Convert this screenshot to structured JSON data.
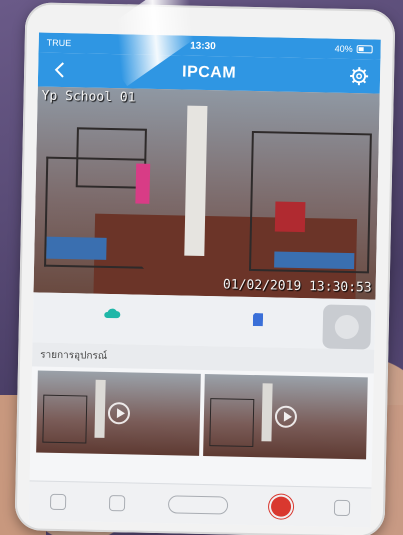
{
  "status_bar": {
    "carrier": "TRUE",
    "time": "13:30",
    "battery": "40%"
  },
  "nav_bar": {
    "title": "IPCAM",
    "back_icon": "chevron-left-icon",
    "settings_icon": "gear-icon"
  },
  "live_view": {
    "camera_label": "Yp School 01",
    "timestamp": "01/02/2019 13:30:53"
  },
  "controls": {
    "cloud_icon": "cloud-icon",
    "sd_icon": "sd-card-icon"
  },
  "device_list": {
    "header": "รายการอุปกรณ์",
    "items": [
      {
        "icon": "play-icon"
      },
      {
        "icon": "play-icon"
      }
    ]
  },
  "colors": {
    "accent": "#2f96e3",
    "record": "#d9382f",
    "cloud": "#1fb7a8",
    "sd": "#3a6fd8"
  }
}
